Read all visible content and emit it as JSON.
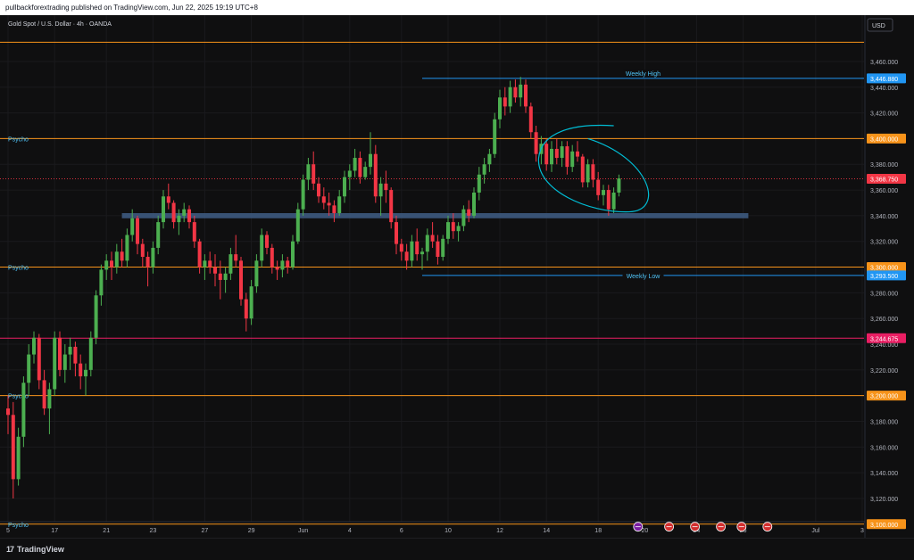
{
  "header": {
    "publisher_text": "pullbackforextrading published on TradingView.com, Jun 22, 2025 19:19 UTC+8"
  },
  "footer": {
    "logo_text": "TradingView",
    "logo_mark": "17"
  },
  "chart_data": {
    "type": "candlestick",
    "title": "Gold Spot / U.S. Dollar · 4h · OANDA",
    "currency": "USD",
    "ylim": [
      3095,
      3478
    ],
    "y_ticks": [
      "3,120.000",
      "3,140.000",
      "3,160.000",
      "3,180.000",
      "3,200.000",
      "3,220.000",
      "3,240.000",
      "3,260.000",
      "3,280.000",
      "3,300.000",
      "3,320.000",
      "3,340.000",
      "3,360.000",
      "3,380.000",
      "3,400.000",
      "3,420.000",
      "3,440.000",
      "3,460.000"
    ],
    "x_ticks": [
      {
        "label": "5",
        "bar": 0
      },
      {
        "label": "17",
        "bar": 9
      },
      {
        "label": "21",
        "bar": 19
      },
      {
        "label": "23",
        "bar": 28
      },
      {
        "label": "27",
        "bar": 38
      },
      {
        "label": "29",
        "bar": 47
      },
      {
        "label": "Jun",
        "bar": 57
      },
      {
        "label": "4",
        "bar": 66
      },
      {
        "label": "6",
        "bar": 76
      },
      {
        "label": "10",
        "bar": 85
      },
      {
        "label": "12",
        "bar": 95
      },
      {
        "label": "14",
        "bar": 104
      },
      {
        "label": "18",
        "bar": 114
      },
      {
        "label": "20",
        "bar": 123
      },
      {
        "label": "24",
        "bar": 133
      },
      {
        "label": "26",
        "bar": 142
      },
      {
        "label": "Jul",
        "bar": 156
      },
      {
        "label": "3",
        "bar": 165
      }
    ],
    "horizontal_levels": [
      {
        "value": 3475,
        "label": "",
        "price_label": "",
        "color": "#f7931a"
      },
      {
        "value": 3400,
        "label": "Psycho",
        "price_label": "3,400.000",
        "color": "#f7931a"
      },
      {
        "value": 3300,
        "label": "Psycho",
        "price_label": "3,300.000",
        "color": "#f7931a"
      },
      {
        "value": 3200,
        "label": "Psycho",
        "price_label": "3,200.000",
        "color": "#f7931a"
      },
      {
        "value": 3100,
        "label": "Psycho",
        "price_label": "3,100.000",
        "color": "#f7931a"
      },
      {
        "value": 3244.675,
        "label": "",
        "price_label": "3,244.675",
        "color": "#e91e63"
      }
    ],
    "annotations": {
      "weekly_high": {
        "label": "Weekly High",
        "value": 3446.88,
        "price_label": "3,446.880",
        "from_bar": 80,
        "color": "#2196f3",
        "text_color": "#4fc3f7"
      },
      "weekly_low": {
        "label": "Weekly Low",
        "value": 3293.5,
        "price_label": "3,293.500",
        "from_bar": 80,
        "color": "#2196f3",
        "text_color": "#4fc3f7"
      },
      "support_zone": {
        "from_bar": 22,
        "to_bar": 143,
        "low": 3338,
        "high": 3342,
        "color": "#3d5a80"
      },
      "last_price": {
        "value": 3368.75,
        "price_label": "3,368.750",
        "color": "#f23645"
      },
      "ellipse_color": "#00bcd4"
    },
    "colors": {
      "up": "#4caf50",
      "down": "#f23645",
      "grid": "#1a1a1d"
    },
    "candles": [
      [
        3190,
        3200,
        3170,
        3185
      ],
      [
        3185,
        3195,
        3120,
        3135
      ],
      [
        3135,
        3175,
        3130,
        3168
      ],
      [
        3168,
        3215,
        3160,
        3210
      ],
      [
        3210,
        3240,
        3200,
        3232
      ],
      [
        3232,
        3250,
        3225,
        3245
      ],
      [
        3245,
        3248,
        3205,
        3212
      ],
      [
        3212,
        3220,
        3185,
        3190
      ],
      [
        3190,
        3210,
        3170,
        3205
      ],
      [
        3205,
        3250,
        3200,
        3245
      ],
      [
        3245,
        3250,
        3215,
        3220
      ],
      [
        3220,
        3240,
        3210,
        3232
      ],
      [
        3232,
        3245,
        3220,
        3238
      ],
      [
        3238,
        3242,
        3215,
        3225
      ],
      [
        3225,
        3232,
        3205,
        3215
      ],
      [
        3215,
        3225,
        3200,
        3220
      ],
      [
        3220,
        3250,
        3215,
        3245
      ],
      [
        3245,
        3282,
        3240,
        3278
      ],
      [
        3278,
        3302,
        3270,
        3298
      ],
      [
        3298,
        3310,
        3290,
        3305
      ],
      [
        3305,
        3312,
        3290,
        3300
      ],
      [
        3300,
        3318,
        3295,
        3312
      ],
      [
        3312,
        3322,
        3300,
        3305
      ],
      [
        3305,
        3330,
        3300,
        3325
      ],
      [
        3325,
        3345,
        3320,
        3338
      ],
      [
        3338,
        3340,
        3310,
        3318
      ],
      [
        3318,
        3322,
        3300,
        3308
      ],
      [
        3308,
        3312,
        3285,
        3300
      ],
      [
        3300,
        3320,
        3295,
        3315
      ],
      [
        3315,
        3340,
        3310,
        3335
      ],
      [
        3335,
        3360,
        3330,
        3355
      ],
      [
        3355,
        3365,
        3345,
        3350
      ],
      [
        3350,
        3352,
        3330,
        3335
      ],
      [
        3335,
        3345,
        3325,
        3340
      ],
      [
        3340,
        3350,
        3335,
        3345
      ],
      [
        3345,
        3348,
        3330,
        3335
      ],
      [
        3335,
        3340,
        3315,
        3320
      ],
      [
        3320,
        3322,
        3295,
        3300
      ],
      [
        3300,
        3310,
        3290,
        3305
      ],
      [
        3305,
        3312,
        3295,
        3300
      ],
      [
        3300,
        3310,
        3285,
        3295
      ],
      [
        3295,
        3305,
        3275,
        3290
      ],
      [
        3290,
        3300,
        3280,
        3295
      ],
      [
        3295,
        3315,
        3290,
        3310
      ],
      [
        3310,
        3325,
        3300,
        3305
      ],
      [
        3305,
        3308,
        3270,
        3275
      ],
      [
        3275,
        3280,
        3250,
        3260
      ],
      [
        3260,
        3290,
        3255,
        3285
      ],
      [
        3285,
        3310,
        3280,
        3305
      ],
      [
        3305,
        3330,
        3300,
        3325
      ],
      [
        3325,
        3328,
        3310,
        3315
      ],
      [
        3315,
        3318,
        3295,
        3300
      ],
      [
        3300,
        3305,
        3290,
        3298
      ],
      [
        3298,
        3310,
        3292,
        3305
      ],
      [
        3305,
        3308,
        3295,
        3300
      ],
      [
        3300,
        3325,
        3298,
        3320
      ],
      [
        3320,
        3350,
        3318,
        3345
      ],
      [
        3345,
        3372,
        3340,
        3368
      ],
      [
        3368,
        3385,
        3360,
        3380
      ],
      [
        3380,
        3390,
        3360,
        3365
      ],
      [
        3365,
        3370,
        3350,
        3355
      ],
      [
        3355,
        3362,
        3345,
        3350
      ],
      [
        3350,
        3358,
        3340,
        3348
      ],
      [
        3348,
        3352,
        3335,
        3342
      ],
      [
        3342,
        3360,
        3340,
        3355
      ],
      [
        3355,
        3375,
        3350,
        3370
      ],
      [
        3370,
        3380,
        3360,
        3375
      ],
      [
        3375,
        3392,
        3370,
        3385
      ],
      [
        3385,
        3390,
        3365,
        3370
      ],
      [
        3370,
        3382,
        3368,
        3378
      ],
      [
        3378,
        3405,
        3372,
        3388
      ],
      [
        3388,
        3395,
        3350,
        3355
      ],
      [
        3355,
        3370,
        3340,
        3365
      ],
      [
        3365,
        3375,
        3350,
        3360
      ],
      [
        3360,
        3362,
        3330,
        3335
      ],
      [
        3335,
        3340,
        3310,
        3318
      ],
      [
        3318,
        3322,
        3305,
        3312
      ],
      [
        3312,
        3318,
        3298,
        3305
      ],
      [
        3305,
        3325,
        3300,
        3320
      ],
      [
        3320,
        3330,
        3305,
        3310
      ],
      [
        3310,
        3315,
        3298,
        3312
      ],
      [
        3312,
        3330,
        3305,
        3325
      ],
      [
        3325,
        3335,
        3315,
        3320
      ],
      [
        3320,
        3325,
        3302,
        3308
      ],
      [
        3308,
        3325,
        3305,
        3322
      ],
      [
        3322,
        3340,
        3318,
        3335
      ],
      [
        3335,
        3342,
        3322,
        3328
      ],
      [
        3328,
        3335,
        3320,
        3332
      ],
      [
        3332,
        3348,
        3328,
        3345
      ],
      [
        3345,
        3352,
        3335,
        3340
      ],
      [
        3340,
        3362,
        3338,
        3358
      ],
      [
        3358,
        3378,
        3352,
        3372
      ],
      [
        3372,
        3385,
        3365,
        3380
      ],
      [
        3380,
        3392,
        3374,
        3388
      ],
      [
        3388,
        3420,
        3385,
        3415
      ],
      [
        3415,
        3438,
        3408,
        3432
      ],
      [
        3432,
        3440,
        3418,
        3425
      ],
      [
        3425,
        3445,
        3420,
        3440
      ],
      [
        3440,
        3446,
        3428,
        3432
      ],
      [
        3432,
        3448,
        3425,
        3442
      ],
      [
        3442,
        3446,
        3420,
        3425
      ],
      [
        3425,
        3428,
        3400,
        3405
      ],
      [
        3405,
        3410,
        3382,
        3388
      ],
      [
        3388,
        3402,
        3380,
        3396
      ],
      [
        3396,
        3400,
        3375,
        3380
      ],
      [
        3380,
        3398,
        3374,
        3392
      ],
      [
        3392,
        3400,
        3380,
        3385
      ],
      [
        3385,
        3398,
        3378,
        3394
      ],
      [
        3394,
        3398,
        3372,
        3378
      ],
      [
        3378,
        3395,
        3374,
        3390
      ],
      [
        3390,
        3398,
        3382,
        3386
      ],
      [
        3386,
        3388,
        3362,
        3366
      ],
      [
        3366,
        3384,
        3362,
        3380
      ],
      [
        3380,
        3384,
        3362,
        3368
      ],
      [
        3368,
        3374,
        3352,
        3356
      ],
      [
        3356,
        3364,
        3348,
        3360
      ],
      [
        3360,
        3364,
        3340,
        3345
      ],
      [
        3345,
        3362,
        3342,
        3358
      ],
      [
        3358,
        3372,
        3355,
        3369
      ]
    ]
  }
}
